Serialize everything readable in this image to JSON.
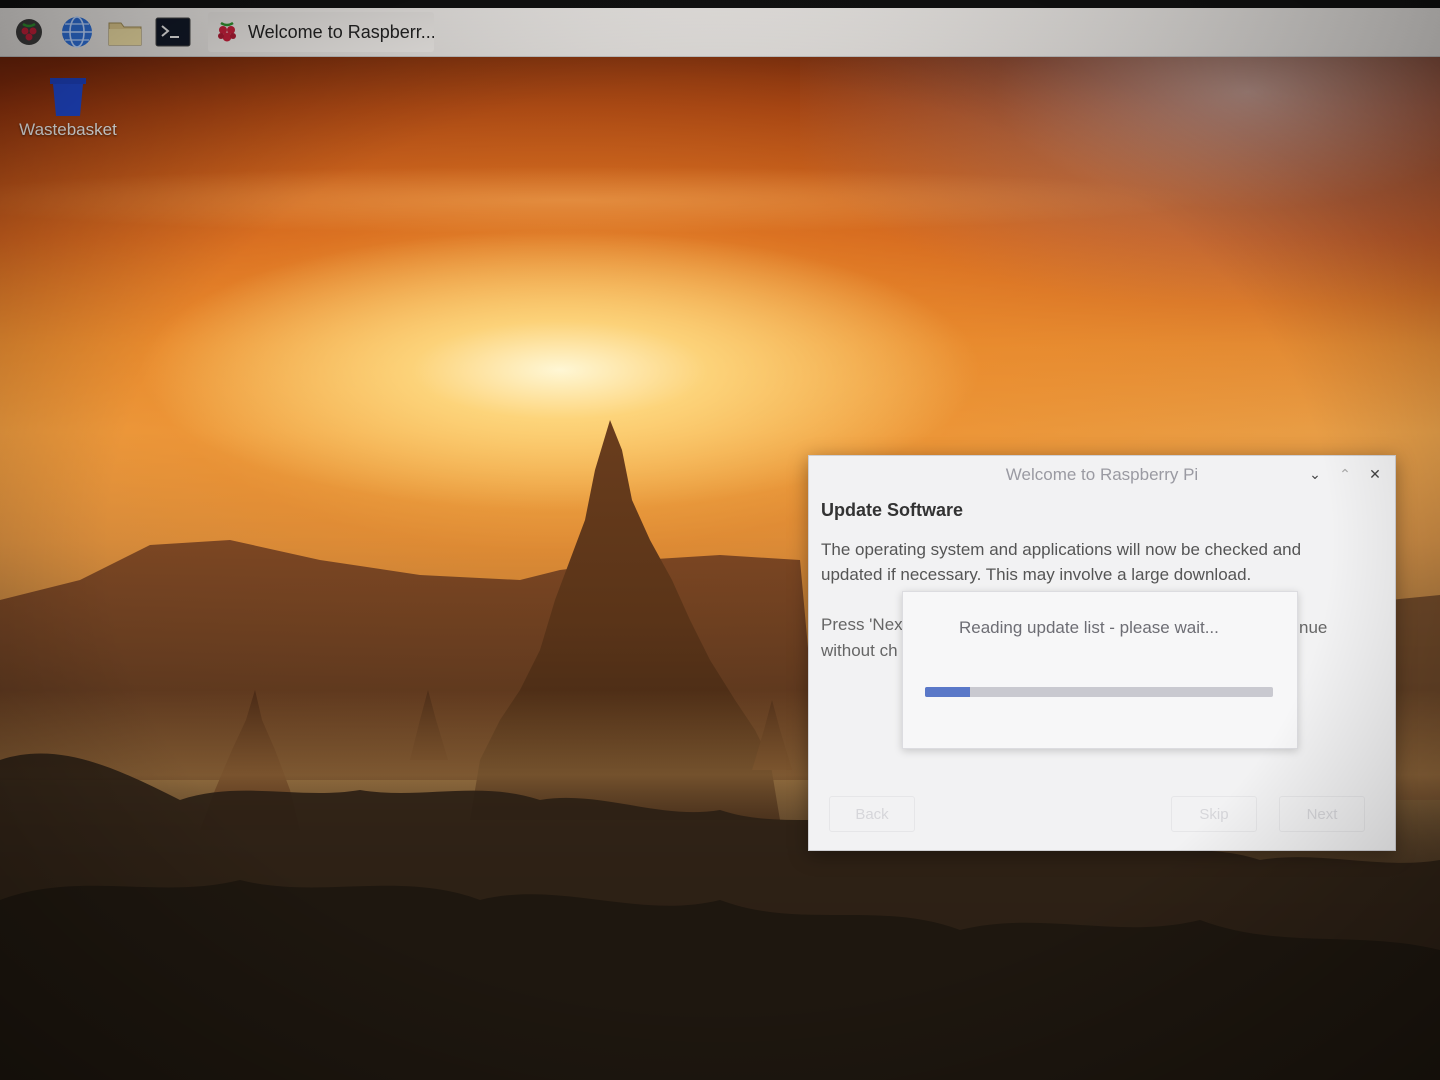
{
  "taskbar": {
    "icons": [
      {
        "name": "raspberry-menu-icon"
      },
      {
        "name": "web-browser-icon"
      },
      {
        "name": "file-manager-icon"
      },
      {
        "name": "terminal-icon"
      }
    ],
    "active_task": {
      "label": "Welcome to Raspberr..."
    }
  },
  "desktop": {
    "icons": [
      {
        "label": "Wastebasket"
      }
    ]
  },
  "dialog": {
    "title": "Welcome to Raspberry Pi",
    "heading": "Update Software",
    "body": "The operating system and applications will now be checked and updated if necessary. This may involve a large download.",
    "press_text": "Press 'Nex",
    "press_text_line2": "without ch",
    "press_text_right": "nue",
    "buttons": {
      "back": "Back",
      "skip": "Skip",
      "next": "Next"
    }
  },
  "progress": {
    "message": "Reading update list - please wait...",
    "fraction": 0.13
  },
  "colors": {
    "progress_fill": "#5a78c8",
    "taskbar": "#e3e0dd"
  }
}
